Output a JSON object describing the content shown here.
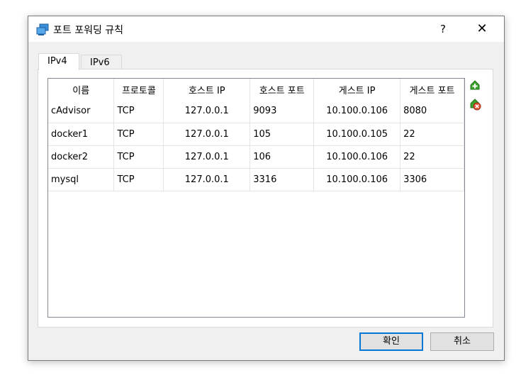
{
  "window": {
    "title": "포트 포워딩 규칙",
    "help_label": "?",
    "close_label": "✕"
  },
  "tabs": [
    {
      "label": "IPv4",
      "active": true
    },
    {
      "label": "IPv6",
      "active": false
    }
  ],
  "table": {
    "headers": [
      "이름",
      "프로토콜",
      "호스트 IP",
      "호스트 포트",
      "게스트 IP",
      "게스트 포트"
    ],
    "rows": [
      [
        "cAdvisor",
        "TCP",
        "127.0.0.1",
        "9093",
        "10.100.0.106",
        "8080"
      ],
      [
        "docker1",
        "TCP",
        "127.0.0.1",
        "105",
        "10.100.0.105",
        "22"
      ],
      [
        "docker2",
        "TCP",
        "127.0.0.1",
        "106",
        "10.100.0.106",
        "22"
      ],
      [
        "mysql",
        "TCP",
        "127.0.0.1",
        "3316",
        "10.100.0.106",
        "3306"
      ]
    ]
  },
  "side_actions": [
    {
      "icon": "add-rule-icon",
      "color": "#3aa52a"
    },
    {
      "icon": "remove-rule-icon",
      "color": "#e0553a"
    }
  ],
  "buttons": {
    "ok_label": "확인",
    "cancel_label": "취소"
  }
}
